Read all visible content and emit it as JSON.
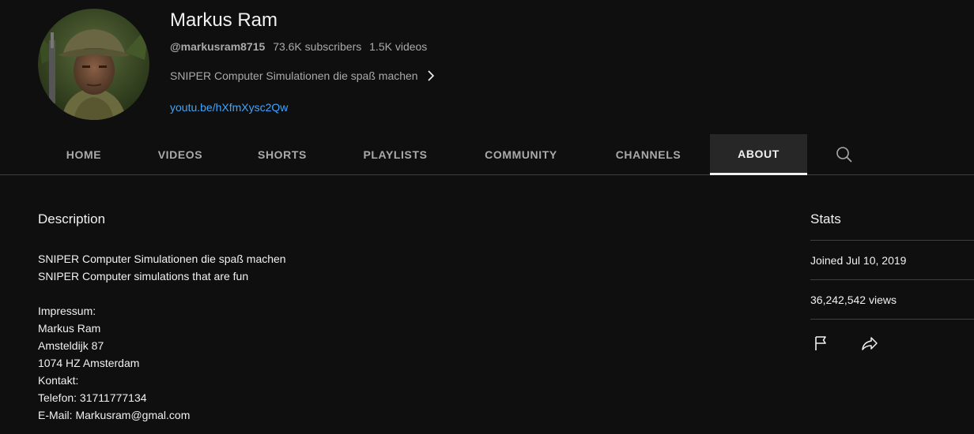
{
  "channel": {
    "name": "Markus Ram",
    "handle": "@markusram8715",
    "subscribers": "73.6K subscribers",
    "videos": "1.5K videos",
    "tagline": "SNIPER Computer Simulationen die spaß machen",
    "link": "youtu.be/hXfmXysc2Qw"
  },
  "tabs": [
    {
      "label": "HOME",
      "active": false
    },
    {
      "label": "VIDEOS",
      "active": false
    },
    {
      "label": "SHORTS",
      "active": false
    },
    {
      "label": "PLAYLISTS",
      "active": false
    },
    {
      "label": "COMMUNITY",
      "active": false
    },
    {
      "label": "CHANNELS",
      "active": false
    },
    {
      "label": "ABOUT",
      "active": true
    }
  ],
  "description": {
    "heading": "Description",
    "lines": [
      "SNIPER Computer Simulationen die spaß machen",
      "SNIPER Computer simulations that are fun",
      "",
      "Impressum:",
      "Markus Ram",
      "Amsteldijk 87",
      "1074 HZ Amsterdam",
      "Kontakt:",
      "Telefon: 31711777134",
      "E-Mail: Markusram@gmal.com"
    ]
  },
  "stats": {
    "heading": "Stats",
    "joined": "Joined Jul 10, 2019",
    "views": "36,242,542 views"
  },
  "icons": {
    "tagline_chevron": "chevron-right-icon",
    "tab_search": "search-icon",
    "report": "flag-icon",
    "share": "share-icon"
  },
  "colors": {
    "background": "#0f0f0f",
    "text": "#f1f1f1",
    "secondary_text": "#aaaaaa",
    "link": "#3ea6ff",
    "divider": "#3f3f3f",
    "active_tab_bg": "#272727"
  }
}
